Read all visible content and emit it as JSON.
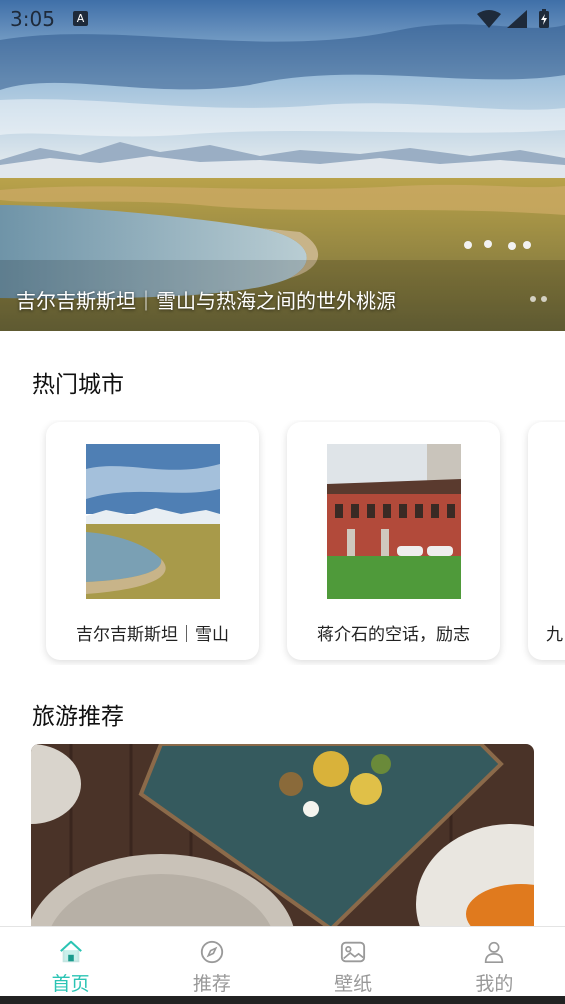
{
  "status_bar": {
    "time": "3:05",
    "notification_badge": "A"
  },
  "banner": {
    "caption": "吉尔吉斯斯坦｜雪山与热海之间的世外桃源",
    "dots": 2
  },
  "hot_cities": {
    "title": "热门城市",
    "cards": [
      {
        "label": "吉尔吉斯斯坦｜雪山"
      },
      {
        "label": "蒋介石的空话，励志"
      },
      {
        "label": "九"
      }
    ]
  },
  "travel": {
    "title": "旅游推荐"
  },
  "bottom_nav": {
    "items": [
      {
        "label": "首页",
        "icon": "home-icon",
        "active": true
      },
      {
        "label": "推荐",
        "icon": "compass-icon",
        "active": false
      },
      {
        "label": "壁纸",
        "icon": "image-icon",
        "active": false
      },
      {
        "label": "我的",
        "icon": "user-icon",
        "active": false
      }
    ]
  },
  "colors": {
    "accent": "#2bc4b4",
    "inactive": "#999999"
  }
}
